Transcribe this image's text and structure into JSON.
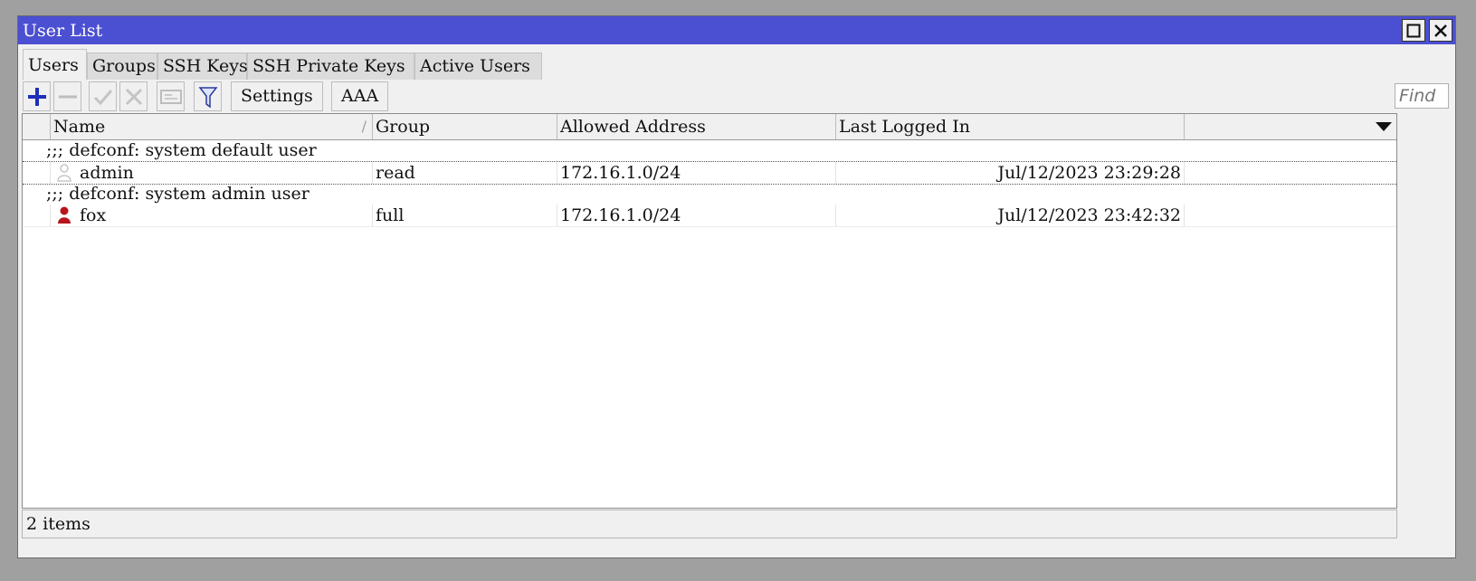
{
  "window": {
    "title": "User List"
  },
  "tabs": [
    {
      "label": "Users",
      "active": true
    },
    {
      "label": "Groups"
    },
    {
      "label": "SSH Keys"
    },
    {
      "label": "SSH Private Keys"
    },
    {
      "label": "Active Users"
    }
  ],
  "toolbar": {
    "add_icon": "plus-icon",
    "remove_icon": "minus-icon",
    "enable_icon": "check-icon",
    "disable_icon": "x-icon",
    "comment_icon": "note-icon",
    "filter_icon": "funnel-icon",
    "settings_label": "Settings",
    "aaa_label": "AAA",
    "find_placeholder": "Find"
  },
  "table": {
    "columns": [
      "Name",
      "Group",
      "Allowed Address",
      "Last Logged In"
    ],
    "rows": [
      {
        "comment": ";;; defconf: system default user",
        "name": "admin",
        "group": "read",
        "address": "172.16.1.0/24",
        "last_login": "Jul/12/2023 23:29:28",
        "icon": "user-grey-icon"
      },
      {
        "comment": ";;; defconf: system admin user",
        "name": "fox",
        "group": "full",
        "address": "172.16.1.0/24",
        "last_login": "Jul/12/2023 23:42:32",
        "icon": "user-red-icon"
      }
    ]
  },
  "status": {
    "text": "2 items"
  },
  "colors": {
    "titlebar": "#4b4fd1",
    "add": "#1f2fb8",
    "user_active": "#b8141c",
    "user_inactive": "#c8c8c8"
  }
}
